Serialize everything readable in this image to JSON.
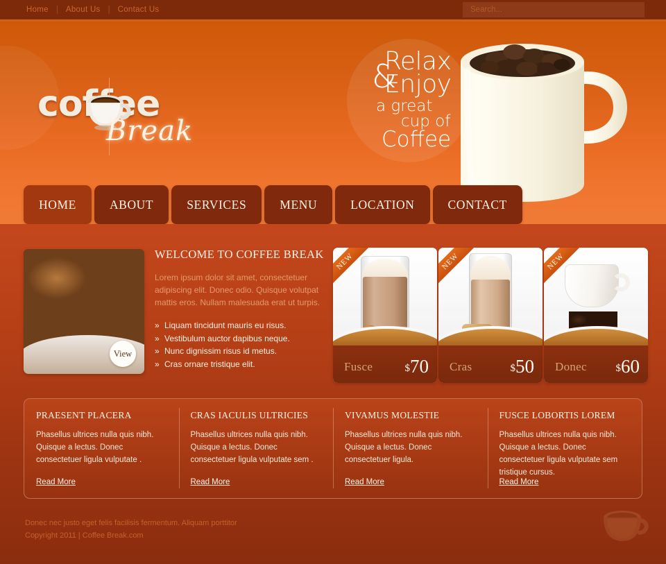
{
  "topbar": {
    "links": [
      {
        "label": "Home",
        "name": "topbar-link-home"
      },
      {
        "label": "About Us",
        "name": "topbar-link-about-us"
      },
      {
        "label": "Contact Us",
        "name": "topbar-link-contact-us"
      }
    ],
    "separator": "|",
    "search": {
      "placeholder": "Search...",
      "value": ""
    }
  },
  "brand": {
    "logo_text": "coffee",
    "logo_script": "Break",
    "logo_icon": "coffee-cup-icon"
  },
  "hero": {
    "slogan_line1": "Relax",
    "slogan_amp": "&",
    "slogan_line2": "Enjoy",
    "slogan_line3": "a great",
    "slogan_line4": "cup of",
    "slogan_line5": "Coffee",
    "image_icon": "coffee-mug-with-beans-image"
  },
  "nav": {
    "items": [
      {
        "label": "HOME",
        "active": true
      },
      {
        "label": "ABOUT",
        "active": false
      },
      {
        "label": "SERVICES",
        "active": false
      },
      {
        "label": "MENU",
        "active": false
      },
      {
        "label": "LOCATION",
        "active": false
      },
      {
        "label": "CONTACT",
        "active": false
      }
    ]
  },
  "feature": {
    "image_icon": "coffee-beans-photo",
    "view_label": "View"
  },
  "welcome": {
    "heading": "WELCOME TO COFFEE BREAK",
    "paragraph": "Lorem ipsum dolor sit amet, consectetuer adipiscing elit. Donec odio. Quisque volutpat mattis eros. Nullam malesuada erat ut turpis.",
    "bullets": [
      "Liquam tincidunt mauris eu risus.",
      "Vestibulum auctor dapibus neque.",
      "Nunc dignissim risus id metus.",
      "Cras ornare tristique elit."
    ]
  },
  "products": {
    "badge_label": "NEW",
    "currency": "$",
    "items": [
      {
        "name": "Fusce",
        "price": "70",
        "image_icon": "latte-glass-with-cookies-photo"
      },
      {
        "name": "Cras",
        "price": "50",
        "image_icon": "latte-glass-with-biscotti-photo"
      },
      {
        "name": "Donec",
        "price": "60",
        "image_icon": "white-cup-with-coffee-beans-photo"
      }
    ]
  },
  "boxes": {
    "read_more_label": "Read More",
    "items": [
      {
        "title": "PRAESENT PLACERA",
        "body": "Phasellus ultrices nulla quis nibh. Quisque a lectus. Donec consectetuer ligula vulputate ."
      },
      {
        "title": "CRAS IACULIS ULTRICIES",
        "body": "Phasellus ultrices nulla quis nibh. Quisque a lectus. Donec consectetuer ligula vulputate sem ."
      },
      {
        "title": "VIVAMUS MOLESTIE",
        "body": "Phasellus ultrices nulla quis nibh. Quisque a lectus. Donec consectetuer ligula."
      },
      {
        "title": "FUSCE LOBORTIS LOREM",
        "body": "Phasellus ultrices nulla quis nibh. Quisque a lectus. Donec consectetuer ligula vulputate sem tristique cursus."
      }
    ]
  },
  "footer": {
    "line1": "Donec nec justo eget felis facilisis fermentum. Aliquam porttitor",
    "line2": "Copyright 2011 | Coffee Break.com",
    "icon": "coffee-cup-icon"
  },
  "colors": {
    "header_top": "#cf5908",
    "header_bottom": "#ef7b37",
    "topbar": "#7d2a0b",
    "main_top": "#c4471c",
    "main_bottom": "#8a2d0e",
    "nav_item": "#80290c",
    "nav_active": "#a2380f",
    "accent_gold": "#d2903d",
    "text_cream": "#fdf4ea",
    "text_muted": "#e49a6c"
  }
}
